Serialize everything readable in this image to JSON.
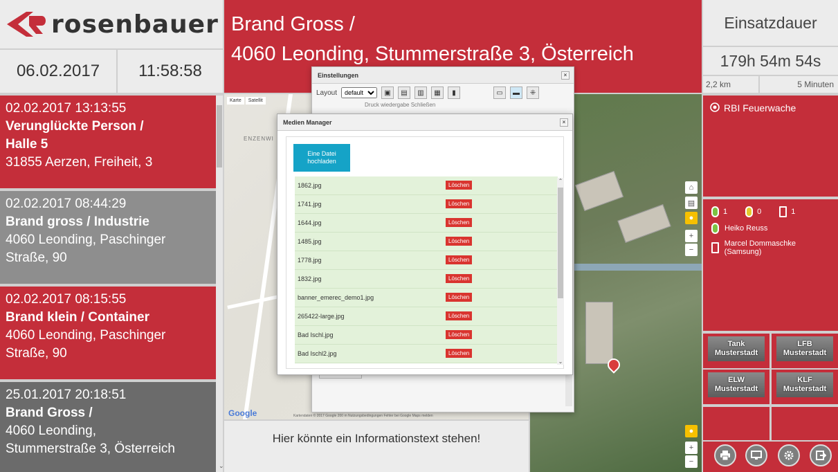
{
  "logo": {
    "text": "rosenbauer"
  },
  "date": "06.02.2017",
  "time": "11:58:58",
  "events": [
    {
      "datetime": "02.02.2017 13:13:55",
      "title": "Verunglückte Person /",
      "subtitle": "Halle 5",
      "address": [
        "31855 Aerzen, Freiheit, 3"
      ]
    },
    {
      "datetime": "02.02.2017 08:44:29",
      "title": "Brand gross / Industrie",
      "subtitle": "",
      "address": [
        "4060 Leonding, Paschinger",
        "Straße, 90"
      ]
    },
    {
      "datetime": "02.02.2017 08:15:55",
      "title": "Brand klein / Container",
      "subtitle": "",
      "address": [
        "4060 Leonding, Paschinger",
        "Straße, 90"
      ]
    },
    {
      "datetime": "25.01.2017 20:18:51",
      "title": "Brand Gross /",
      "subtitle": "",
      "address": [
        "4060 Leonding,",
        "Stummerstraße 3, Österreich"
      ]
    }
  ],
  "header": {
    "line1": "Brand Gross /",
    "line2": "4060 Leonding, Stummerstraße 3, Österreich"
  },
  "duration": {
    "title": "Einsatzdauer",
    "value": "179h 54m 54s",
    "distance": "2,2 km",
    "eta": "5 Minuten"
  },
  "station": {
    "label": "RBI Feuerwache"
  },
  "crew": {
    "counts": [
      "1",
      "0",
      "1"
    ],
    "members": [
      "Heiko Reuss",
      "Marcel Dommaschke (Samsung)"
    ]
  },
  "vehicles": [
    {
      "line1": "Tank",
      "line2": "Musterstadt"
    },
    {
      "line1": "LFB",
      "line2": "Musterstadt"
    },
    {
      "line1": "ELW",
      "line2": "Musterstadt"
    },
    {
      "line1": "KLF",
      "line2": "Musterstadt"
    }
  ],
  "map": {
    "tabs": [
      "Karte",
      "Satellit"
    ],
    "google": "Google",
    "place_label": "ENZENWI",
    "footer": "Kartendaten © 2017 Google   200 m   Nutzungsbedingungen   Fehler bei Google Maps melden"
  },
  "info_text": "Hier könnte ein Informationstext stehen!",
  "settings": {
    "title": "Einstellungen",
    "layout_label": "Layout",
    "layout_value": "default",
    "underline_text": "Druck wiedergabe   Schließen"
  },
  "media": {
    "title": "Medien Manager",
    "upload_label": "Eine Datei hochladen",
    "delete_label": "Löschen",
    "files": [
      "1862.jpg",
      "1741.jpg",
      "1644.jpg",
      "1485.jpg",
      "1778.jpg",
      "1832.jpg",
      "banner_emerec_demo1.jpg",
      "265422-large.jpg",
      "Bad Ischl.jpg",
      "Bad Ischl2.jpg"
    ]
  },
  "colors": {
    "brand_red": "#c42e3a",
    "upload_blue": "#15a3c7",
    "delete_red": "#d9342f",
    "row_green": "#e3f2da"
  },
  "icons": {
    "close": "close-icon",
    "print": "print-icon",
    "monitor": "monitor-icon",
    "settings": "gear-icon",
    "logout": "logout-icon"
  }
}
